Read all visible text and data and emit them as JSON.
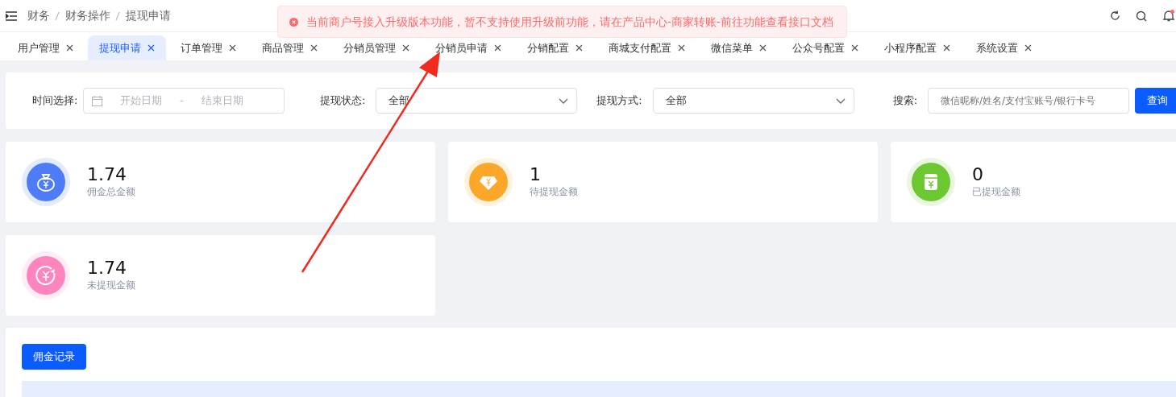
{
  "breadcrumb": [
    "财务",
    "财务操作",
    "提现申请"
  ],
  "toast": {
    "kind": "error",
    "message": "当前商户号接入升级版本功能，暂不支持使用升级前功能，请在产品中心-商家转账-前往功能查看接口文档"
  },
  "notifications": {
    "unread": true
  },
  "tabs": [
    {
      "label": "用户管理",
      "selected": false
    },
    {
      "label": "提现申请",
      "selected": true
    },
    {
      "label": "订单管理",
      "selected": false
    },
    {
      "label": "商品管理",
      "selected": false
    },
    {
      "label": "分销员管理",
      "selected": false
    },
    {
      "label": "分销员申请",
      "selected": false
    },
    {
      "label": "分销配置",
      "selected": false
    },
    {
      "label": "商城支付配置",
      "selected": false
    },
    {
      "label": "微信菜单",
      "selected": false
    },
    {
      "label": "公众号配置",
      "selected": false
    },
    {
      "label": "小程序配置",
      "selected": false
    },
    {
      "label": "系统设置",
      "selected": false
    }
  ],
  "filters": {
    "time_label": "时间选择:",
    "start_placeholder": "开始日期",
    "separator": "-",
    "end_placeholder": "结束日期",
    "status_label": "提现状态:",
    "status_value": "全部",
    "method_label": "提现方式:",
    "method_value": "全部",
    "search_label": "搜索:",
    "search_placeholder": "微信昵称/姓名/支付宝账号/银行卡号",
    "query_button": "查询"
  },
  "stats": [
    {
      "kind": "moneybag",
      "value": "1.74",
      "label": "佣金总金额",
      "color": "#4e7cf6"
    },
    {
      "kind": "diamond",
      "value": "1",
      "label": "待提现金额",
      "color": "#fba72a"
    },
    {
      "kind": "wallet",
      "value": "0",
      "label": "已提现金额",
      "color": "#6cc830"
    },
    {
      "kind": "refund",
      "value": "1.74",
      "label": "未提现金额",
      "color": "#fe84bd"
    }
  ],
  "records_button": "佣金记录"
}
